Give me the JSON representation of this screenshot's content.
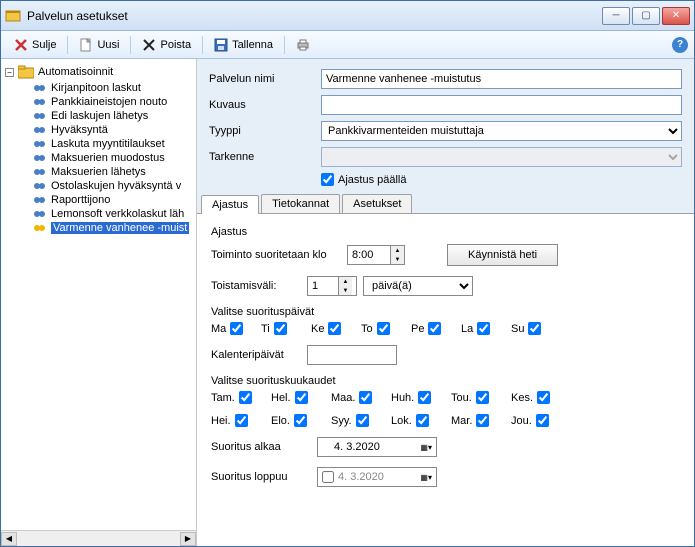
{
  "window": {
    "title": "Palvelun asetukset"
  },
  "toolbar": {
    "close": "Sulje",
    "new": "Uusi",
    "delete": "Poista",
    "save": "Tallenna"
  },
  "tree": {
    "root": "Automatisoinnit",
    "items": [
      "Kirjanpitoon laskut",
      "Pankkiaineistojen nouto",
      "Edi laskujen lähetys",
      "Hyväksyntä",
      "Laskuta myyntitilaukset",
      "Maksuerien muodostus",
      "Maksuerien lähetys",
      "Ostolaskujen hyväksyntä v",
      "Raporttijono",
      "Lemonsoft verkkolaskut läh",
      "Varmenne vanhenee -muist"
    ]
  },
  "form": {
    "name_label": "Palvelun nimi",
    "name_value": "Varmenne vanhenee -muistutus",
    "desc_label": "Kuvaus",
    "desc_value": "",
    "type_label": "Tyyppi",
    "type_value": "Pankkivarmenteiden muistuttaja",
    "spec_label": "Tarkenne",
    "spec_value": "",
    "timer_on": "Ajastus päällä"
  },
  "tabs": [
    "Ajastus",
    "Tietokannat",
    "Asetukset"
  ],
  "schedule": {
    "group": "Ajastus",
    "run_at_label": "Toiminto suoritetaan klo",
    "run_at_value": "8:00",
    "run_now": "Käynnistä heti",
    "repeat_label": "Toistamisväli:",
    "repeat_value": "1",
    "repeat_unit": "päivä(ä)",
    "days_label": "Valitse suorituspäivät",
    "days": [
      "Ma",
      "Ti",
      "Ke",
      "To",
      "Pe",
      "La",
      "Su"
    ],
    "calendar_days_label": "Kalenteripäivät",
    "calendar_days_value": "",
    "months_label": "Valitse suorituskuukaudet",
    "months_row1": [
      "Tam.",
      "Hel.",
      "Maa.",
      "Huh.",
      "Tou.",
      "Kes."
    ],
    "months_row2": [
      "Hei.",
      "Elo.",
      "Syy.",
      "Lok.",
      "Mar.",
      "Jou."
    ],
    "start_label": "Suoritus alkaa",
    "start_value": "4. 3.2020",
    "end_label": "Suoritus loppuu",
    "end_value": "4. 3.2020"
  }
}
